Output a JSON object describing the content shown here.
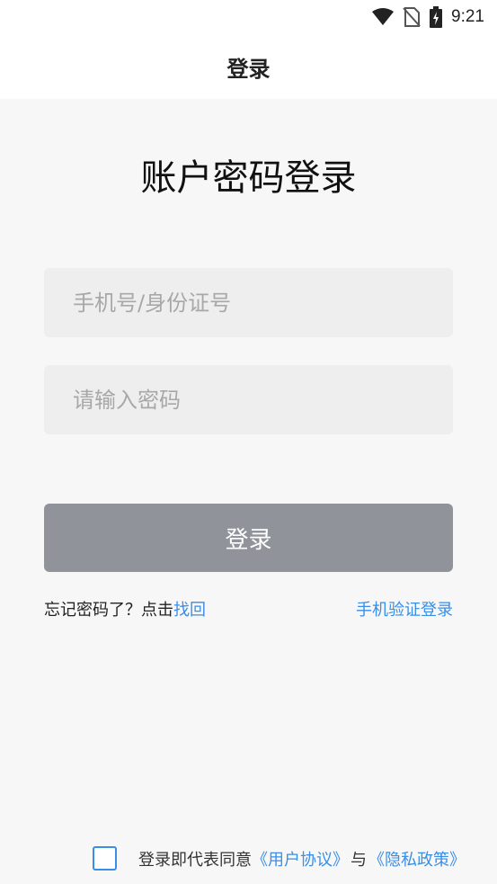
{
  "status_bar": {
    "time": "9:21",
    "icons": [
      "wifi-icon",
      "no-sim-icon",
      "battery-charging-icon"
    ]
  },
  "header": {
    "title": "登录"
  },
  "main": {
    "heading": "账户密码登录",
    "phone_placeholder": "手机号/身份证号",
    "password_placeholder": "请输入密码",
    "login_button": "登录",
    "forgot_prefix": "忘记密码了？点击",
    "forgot_link": "找回",
    "sms_login_link": "手机验证登录"
  },
  "agreement": {
    "prefix": "登录即代表同意",
    "user_agreement": "《用户协议》",
    "connector": "与",
    "privacy_policy": "《隐私政策》"
  },
  "colors": {
    "accent": "#3a8ee6",
    "button_disabled": "#909399",
    "background": "#f7f7f7",
    "input_bg": "#eeeeef"
  }
}
